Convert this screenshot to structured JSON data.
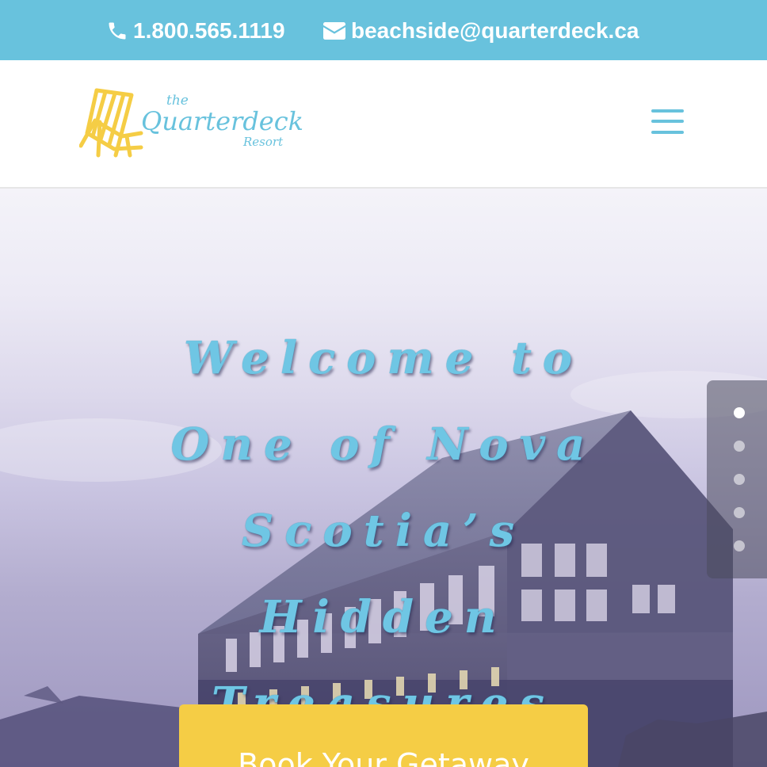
{
  "topbar": {
    "phone": "1.800.565.1119",
    "email": "beachside@quarterdeck.ca",
    "phone_icon": "phone-icon",
    "email_icon": "envelope-icon"
  },
  "header": {
    "logo": {
      "the": "the",
      "name": "Quarterdeck",
      "resort": "Resort",
      "icon": "beach-chair-icon"
    },
    "menu_icon": "hamburger-menu-icon"
  },
  "hero": {
    "title": "Welcome to One of Nova Scotia’s Hidden Treasures",
    "cta_label": "Book Your Getaway"
  },
  "slider": {
    "slides": [
      "1",
      "2",
      "3",
      "4",
      "5"
    ],
    "active_index": 0
  },
  "colors": {
    "accent_blue": "#68c2dd",
    "title_blue": "#6fc6e4",
    "accent_yellow": "#f5cd45",
    "white": "#ffffff"
  }
}
